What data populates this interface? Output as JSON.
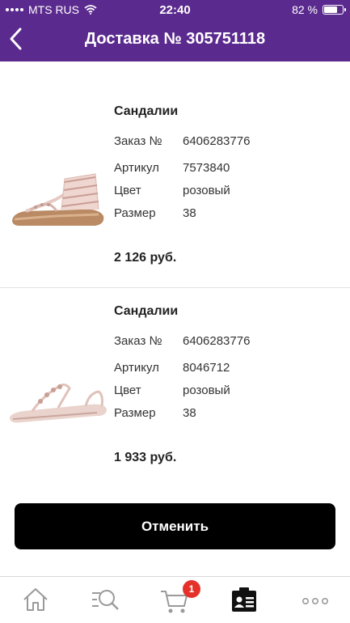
{
  "status_bar": {
    "carrier": "MTS RUS",
    "time": "22:40",
    "battery_percent": "82 %",
    "battery_level": 0.82
  },
  "header": {
    "title": "Доставка № 305751118",
    "back_icon": "chevron-left-icon"
  },
  "items": [
    {
      "name": "Сандалии",
      "order_label": "Заказ №",
      "order_value": "6406283776",
      "article_label": "Артикул",
      "article_value": "7573840",
      "color_label": "Цвет",
      "color_value": "розовый",
      "size_label": "Размер",
      "size_value": "38",
      "price": "2 126 руб."
    },
    {
      "name": "Сандалии",
      "order_label": "Заказ №",
      "order_value": "6406283776",
      "article_label": "Артикул",
      "article_value": "8046712",
      "color_label": "Цвет",
      "color_value": "розовый",
      "size_label": "Размер",
      "size_value": "38",
      "price": "1 933 руб."
    }
  ],
  "cancel_button": {
    "label": "Отменить"
  },
  "tabbar": {
    "tabs": [
      "home-icon",
      "search-icon",
      "cart-icon",
      "profile-card-icon",
      "more-icon"
    ],
    "cart_badge": "1"
  },
  "colors": {
    "header": "#5b2a8e",
    "button": "#000000",
    "badge": "#e4322b"
  }
}
